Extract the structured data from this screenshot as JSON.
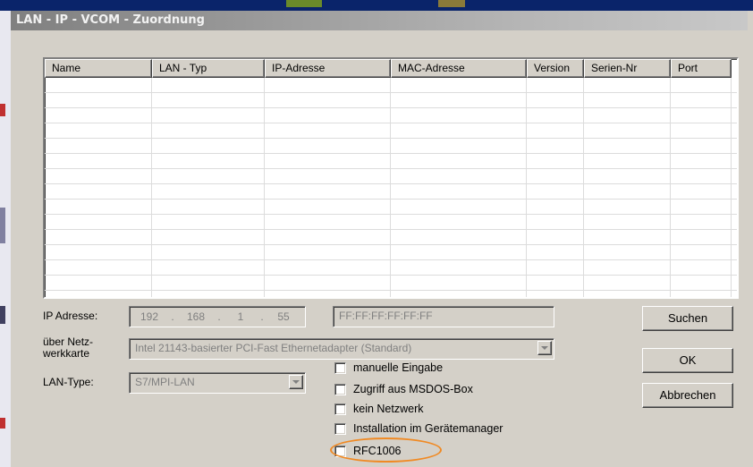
{
  "window": {
    "title": "LAN - IP - VCOM - Zuordnung"
  },
  "table": {
    "columns": [
      "Name",
      "LAN - Typ",
      "IP-Adresse",
      "MAC-Adresse",
      "Version",
      "Serien-Nr",
      "Port"
    ],
    "rows": []
  },
  "form": {
    "ip_label": "IP Adresse:",
    "ip_octets": [
      "192",
      "168",
      "1",
      "55"
    ],
    "ip_separator": ".",
    "mac_value": "FF:FF:FF:FF:FF:FF",
    "netzwerkkarte_label_line1": "über Netz-",
    "netzwerkkarte_label_line2": "werkkarte",
    "netzwerkkarte_value": "Intel 21143-basierter PCI-Fast Ethernetadapter (Standard)",
    "lan_type_label": "LAN-Type:",
    "lan_type_value": "S7/MPI-LAN"
  },
  "checkboxes": [
    {
      "label": "manuelle Eingabe",
      "checked": false
    },
    {
      "label": "Zugriff aus MSDOS-Box",
      "checked": false
    },
    {
      "label": "kein Netzwerk",
      "checked": false
    },
    {
      "label": "Installation im Gerätemanager",
      "checked": false
    },
    {
      "label": "RFC1006",
      "checked": false
    }
  ],
  "buttons": {
    "suchen": "Suchen",
    "ok": "OK",
    "abbrechen": "Abbrechen"
  },
  "colors": {
    "highlight": "#f08a24",
    "dialog_face": "#d4d0c8"
  }
}
